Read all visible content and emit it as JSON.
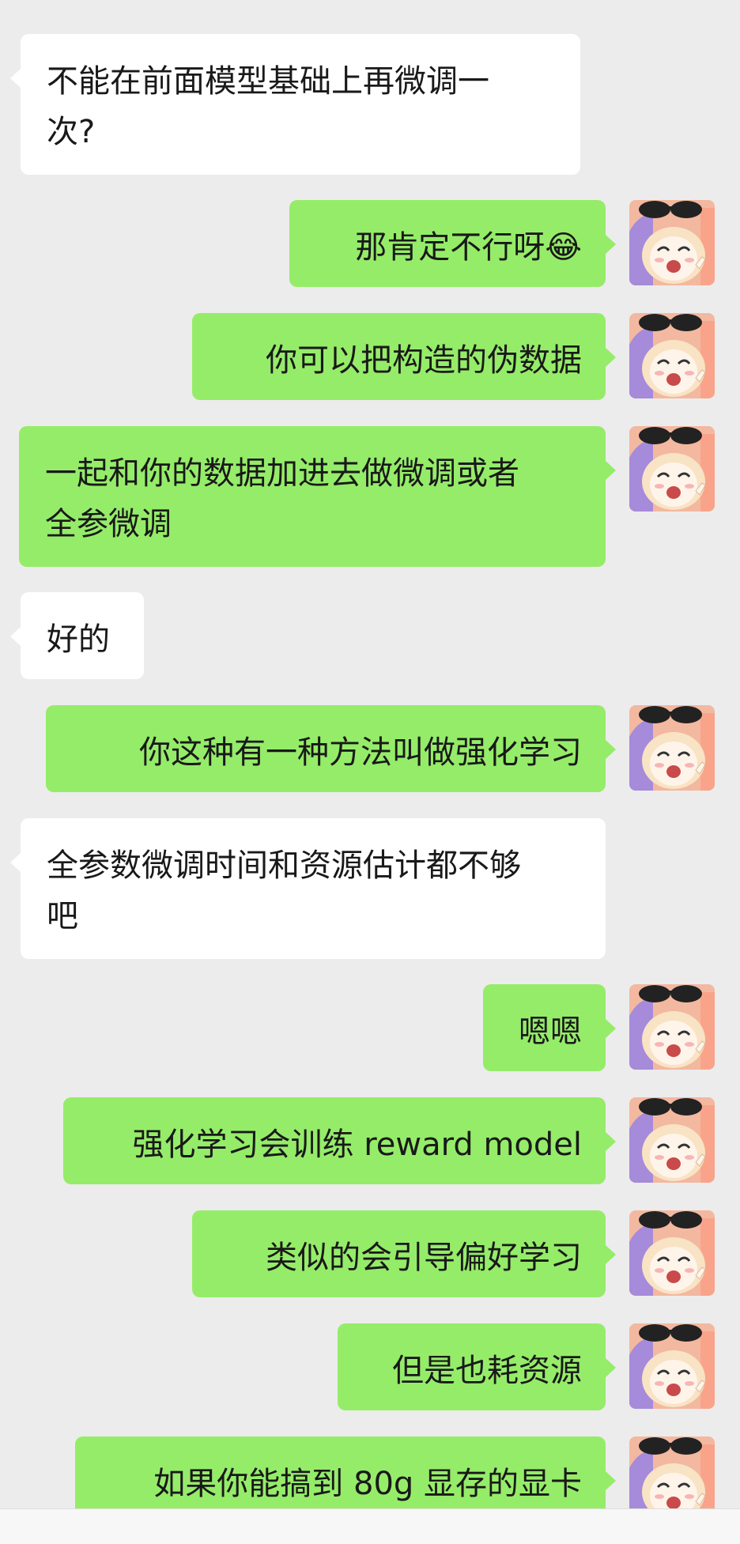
{
  "messages": [
    {
      "side": "left",
      "text": "不能在前面模型基础上再微调一\n次?"
    },
    {
      "side": "right",
      "text": "那肯定不行呀",
      "emoji": "😂"
    },
    {
      "side": "right",
      "text": "你可以把构造的伪数据"
    },
    {
      "side": "right",
      "text": "一起和你的数据加进去做微调或者\n全参微调"
    },
    {
      "side": "left",
      "text": "好的"
    },
    {
      "side": "right",
      "text": "你这种有一种方法叫做强化学习"
    },
    {
      "side": "left",
      "text": "全参数微调时间和资源估计都不够\n吧"
    },
    {
      "side": "right",
      "text": "嗯嗯"
    },
    {
      "side": "right",
      "text": "强化学习会训练 reward model"
    },
    {
      "side": "right",
      "text": "类似的会引导偏好学习"
    },
    {
      "side": "right",
      "text": "但是也耗资源"
    },
    {
      "side": "right",
      "text": "如果你能搞到 80g 显存的显卡"
    }
  ],
  "colors": {
    "self_bubble": "#95ec69",
    "other_bubble": "#ffffff",
    "background": "#ececec",
    "text": "#191919"
  },
  "icons": {
    "avatar": "anime-girl-with-sunglasses-avatar",
    "emoji": "tears-of-joy-emoji"
  }
}
